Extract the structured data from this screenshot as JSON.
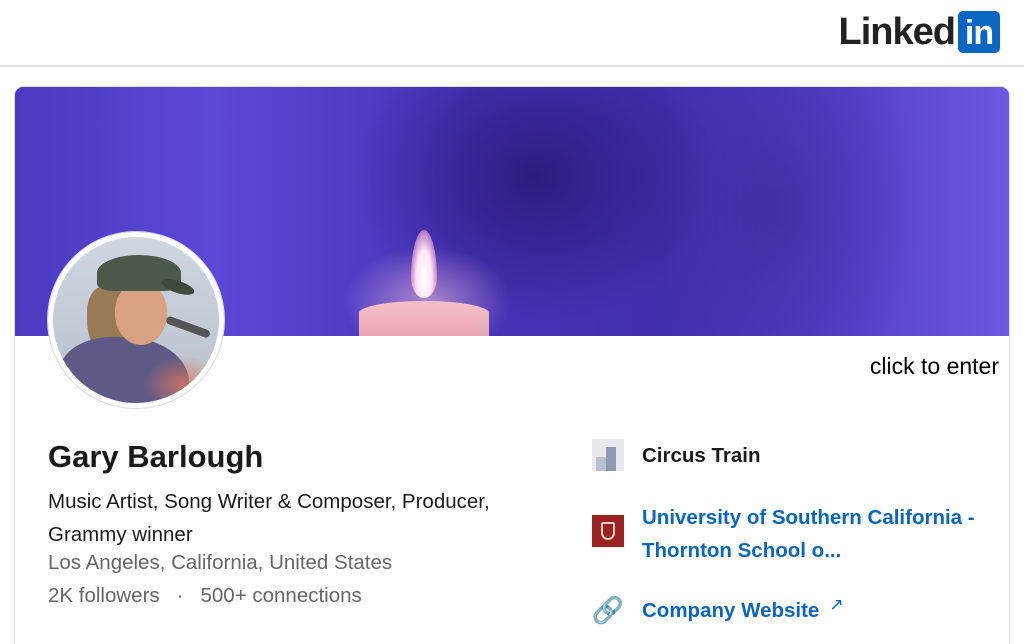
{
  "brand": {
    "logo_text": "Linked",
    "logo_box": "in",
    "accent": "#0a66c2"
  },
  "banner": {
    "overlay_text": "click to enter"
  },
  "profile": {
    "name": "Gary Barlough",
    "headline": "Music Artist, Song Writer & Composer, Producer, Grammy winner",
    "location": "Los Angeles, California, United States",
    "followers": "2K followers",
    "separator": "·",
    "connections": "500+ connections"
  },
  "sidebar": {
    "company": {
      "label": "Circus Train",
      "icon": "company-logo-icon"
    },
    "school": {
      "label": "University of Southern California - Thornton School o...",
      "icon": "school-logo-icon"
    },
    "website": {
      "label": "Company Website",
      "icon": "link-icon",
      "external_icon": "external-link-icon"
    }
  },
  "colors": {
    "link": "#0a66c2",
    "secondary_text": "#666666",
    "banner": "#4a3bc0"
  }
}
